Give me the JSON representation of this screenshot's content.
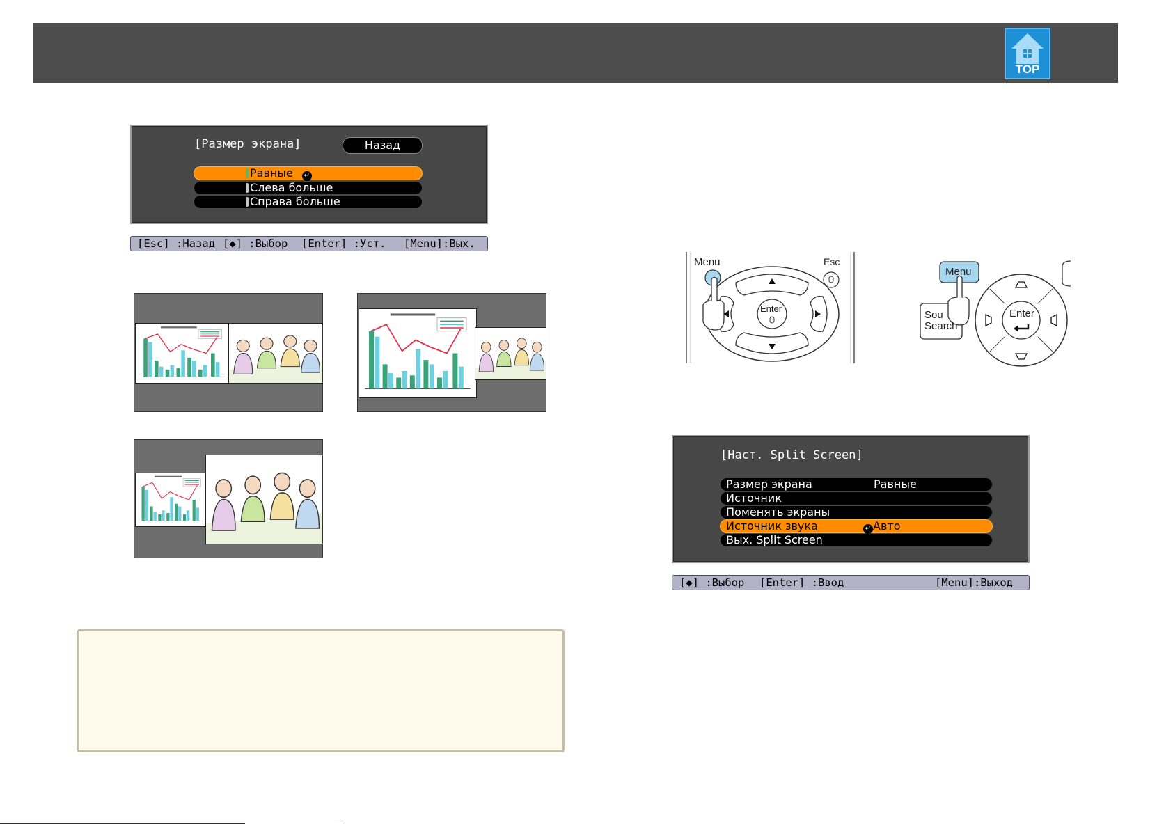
{
  "header": {
    "top_label": "TOP"
  },
  "menu1": {
    "title": "[Размер экрана]",
    "back_label": "Назад",
    "items": [
      "Равные",
      "Слева больше",
      "Справа больше"
    ],
    "selected_index": 0
  },
  "help1": {
    "esc": "[Esc] :Назад",
    "arrows": "[◆] :Выбор",
    "enter": "[Enter] :Уст.",
    "menu": "[Menu]:Вых."
  },
  "remote": {
    "menu_label": "Menu",
    "esc_label": "Esc",
    "enter_label": "Enter"
  },
  "panel": {
    "menu_label": "Menu",
    "source_search_line1": "Sou",
    "source_search_line2": "Search",
    "enter_label": "Enter"
  },
  "menu2": {
    "title": "[Наст. Split Screen]",
    "items": [
      {
        "label": "Размер экрана",
        "value": "Равные"
      },
      {
        "label": "Источник",
        "value": ""
      },
      {
        "label": "Поменять экраны",
        "value": ""
      },
      {
        "label": "Источник звука",
        "value": "Авто"
      },
      {
        "label": "Вых. Split Screen",
        "value": ""
      }
    ],
    "selected_index": 3
  },
  "help2": {
    "arrows": "[◆] :Выбор",
    "enter": "[Enter] :Ввод",
    "menu": "[Menu]:Выход"
  },
  "colors": {
    "header_bg": "#4d4d4d",
    "osd_bg": "#474747",
    "selected": "#ff8c00",
    "top_icon": "#1e90d6",
    "note_bg": "#fefaec"
  }
}
